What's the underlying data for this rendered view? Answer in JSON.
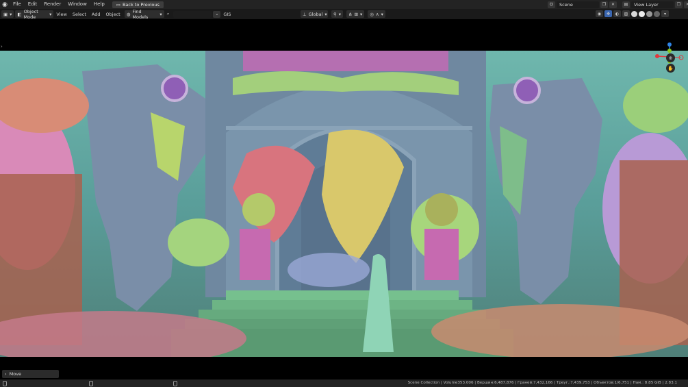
{
  "menubar": {
    "items": [
      "File",
      "Edit",
      "Render",
      "Window",
      "Help"
    ],
    "back_button": "Back to Previous",
    "scene_name": "Scene",
    "view_layer": "View Layer"
  },
  "viewport_header": {
    "mode": "Object Mode",
    "menus": [
      "View",
      "Select",
      "Add",
      "Object"
    ],
    "find_models": "Find Models",
    "gis": "GIS",
    "orientation": "Global"
  },
  "gizmo": {
    "axes": [
      "X",
      "Y",
      "Z"
    ],
    "colors": {
      "x": "#e0393e",
      "y": "#8ac81d",
      "z": "#2f83e4"
    }
  },
  "operator_panel": {
    "label": "Move"
  },
  "statusbar": {
    "text": "Scene Collection | Volume353.006 | Вершин:6,487,876 | Граней:7,432,166 | Треуг.:7,439,753 | Объектов:1/6,751 | Пам.: 8.85 GiB | 2.83.1"
  },
  "scene": {
    "description_icons": [
      "statue-left",
      "statue-right",
      "gate",
      "arch",
      "stairs",
      "hooded-figure"
    ]
  }
}
